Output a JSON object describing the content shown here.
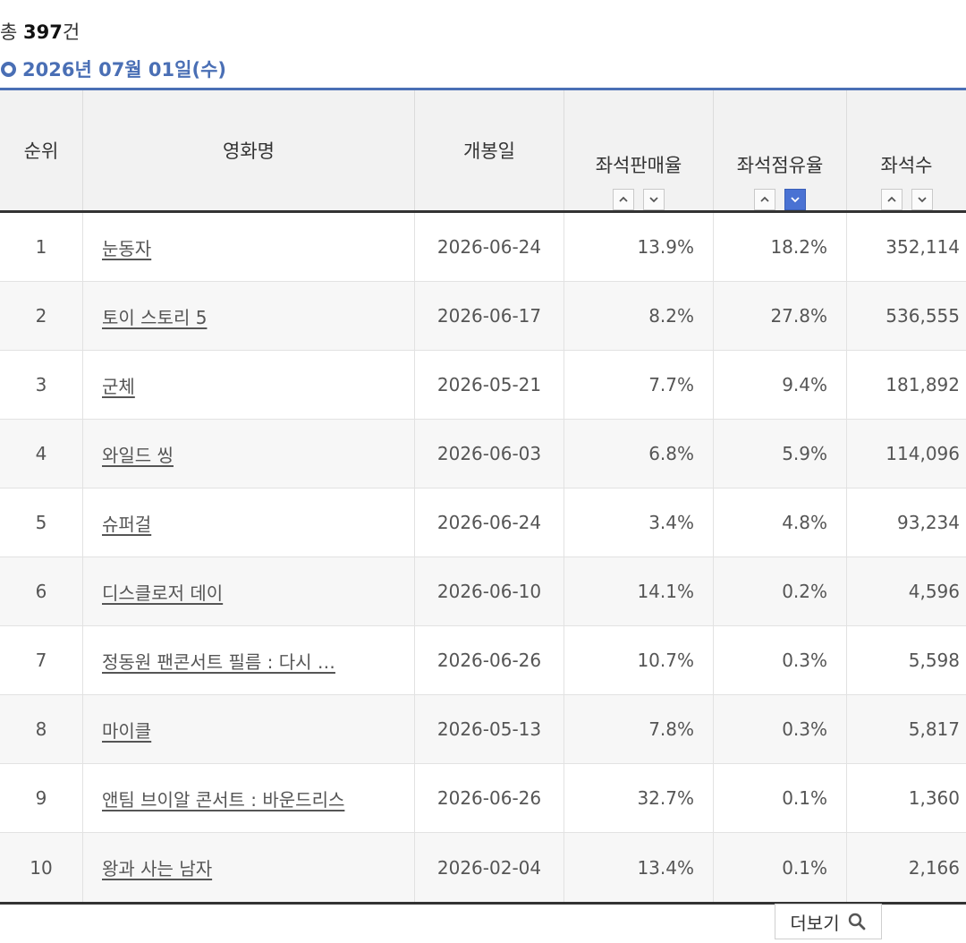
{
  "summary": {
    "prefix": "총",
    "count": "397",
    "suffix": "건"
  },
  "date_title": "2026년 07월 01일(수)",
  "table": {
    "headers": {
      "rank": "순위",
      "title": "영화명",
      "open_date": "개봉일",
      "seat_sales_rate": "좌석판매율",
      "seat_share_rate": "좌석점유율",
      "seats": "좌석수"
    },
    "active_sort": "seat_share_rate-desc",
    "rows": [
      {
        "rank": "1",
        "title": "눈동자",
        "open_date": "2026-06-24",
        "seat_sales_rate": "13.9%",
        "seat_share_rate": "18.2%",
        "seats": "352,114"
      },
      {
        "rank": "2",
        "title": "토이 스토리 5",
        "open_date": "2026-06-17",
        "seat_sales_rate": "8.2%",
        "seat_share_rate": "27.8%",
        "seats": "536,555"
      },
      {
        "rank": "3",
        "title": "군체",
        "open_date": "2026-05-21",
        "seat_sales_rate": "7.7%",
        "seat_share_rate": "9.4%",
        "seats": "181,892"
      },
      {
        "rank": "4",
        "title": "와일드 씽",
        "open_date": "2026-06-03",
        "seat_sales_rate": "6.8%",
        "seat_share_rate": "5.9%",
        "seats": "114,096"
      },
      {
        "rank": "5",
        "title": "슈퍼걸",
        "open_date": "2026-06-24",
        "seat_sales_rate": "3.4%",
        "seat_share_rate": "4.8%",
        "seats": "93,234"
      },
      {
        "rank": "6",
        "title": "디스클로저 데이",
        "open_date": "2026-06-10",
        "seat_sales_rate": "14.1%",
        "seat_share_rate": "0.2%",
        "seats": "4,596"
      },
      {
        "rank": "7",
        "title": "정동원 팬콘서트 필름 : 다시 …",
        "open_date": "2026-06-26",
        "seat_sales_rate": "10.7%",
        "seat_share_rate": "0.3%",
        "seats": "5,598"
      },
      {
        "rank": "8",
        "title": "마이클",
        "open_date": "2026-05-13",
        "seat_sales_rate": "7.8%",
        "seat_share_rate": "0.3%",
        "seats": "5,817"
      },
      {
        "rank": "9",
        "title": "앤팀 브이알 콘서트 : 바운드리스",
        "open_date": "2026-06-26",
        "seat_sales_rate": "32.7%",
        "seat_share_rate": "0.1%",
        "seats": "1,360"
      },
      {
        "rank": "10",
        "title": "왕과 사는 남자",
        "open_date": "2026-02-04",
        "seat_sales_rate": "13.4%",
        "seat_share_rate": "0.1%",
        "seats": "2,166"
      }
    ]
  },
  "more_button": {
    "label": "더보기",
    "icon": "search-icon"
  },
  "colors": {
    "accent": "#4a6fb5",
    "active_sort": "#4a72d3",
    "header_bg": "#f2f2f2"
  }
}
